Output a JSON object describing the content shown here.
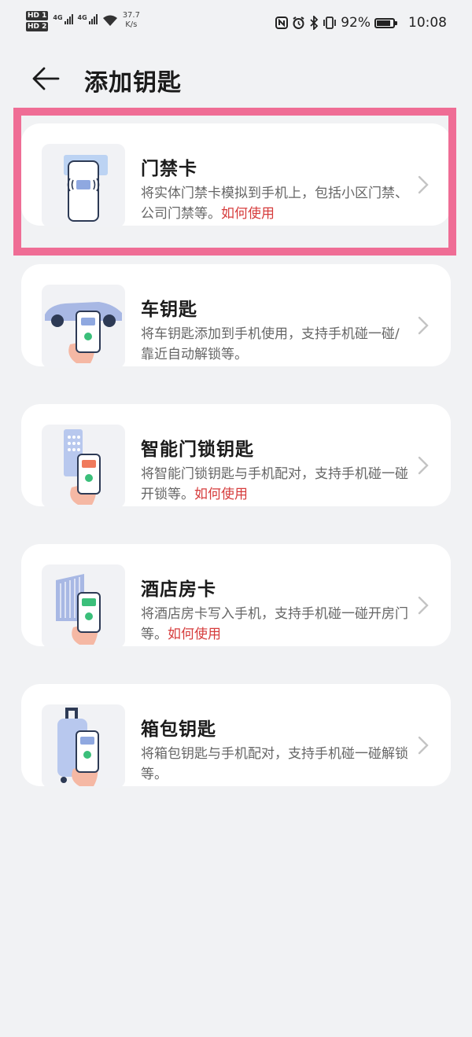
{
  "status_bar": {
    "sim1": "HD 1",
    "sim2": "HD 2",
    "net1": "4G",
    "net2": "4G",
    "speed_value": "37.7",
    "speed_unit": "K/s",
    "battery_percent": "92%",
    "battery_level": 0.92,
    "time": "10:08",
    "icons": [
      "nfc-icon",
      "alarm-icon",
      "bluetooth-icon",
      "vibrate-icon",
      "battery-icon"
    ]
  },
  "header": {
    "title": "添加钥匙",
    "back_icon": "arrow-left-icon"
  },
  "cards": [
    {
      "id": "access-card",
      "title": "门禁卡",
      "desc": "将实体门禁卡模拟到手机上，包括小区门禁、公司门禁等。",
      "link": "如何使用",
      "icon": "access-card-illustration"
    },
    {
      "id": "car-key",
      "title": "车钥匙",
      "desc": "将车钥匙添加到手机使用，支持手机碰一碰/靠近自动解锁等。",
      "link": "",
      "icon": "car-key-illustration"
    },
    {
      "id": "smart-lock-key",
      "title": "智能门锁钥匙",
      "desc": "将智能门锁钥匙与手机配对，支持手机碰一碰开锁等。",
      "link": "如何使用",
      "icon": "smart-lock-illustration"
    },
    {
      "id": "hotel-card",
      "title": "酒店房卡",
      "desc": "将酒店房卡写入手机，支持手机碰一碰开房门等。",
      "link": "如何使用",
      "icon": "hotel-card-illustration"
    },
    {
      "id": "luggage-key",
      "title": "箱包钥匙",
      "desc": "将箱包钥匙与手机配对，支持手机碰一碰解锁等。",
      "link": "",
      "icon": "luggage-illustration"
    }
  ],
  "colors": {
    "background": "#f1f2f4",
    "card": "#ffffff",
    "link": "#d63c3c",
    "highlight": "#ef6d95",
    "accent_green": "#3bbf7a",
    "accent_blue": "#8fa8e0"
  }
}
